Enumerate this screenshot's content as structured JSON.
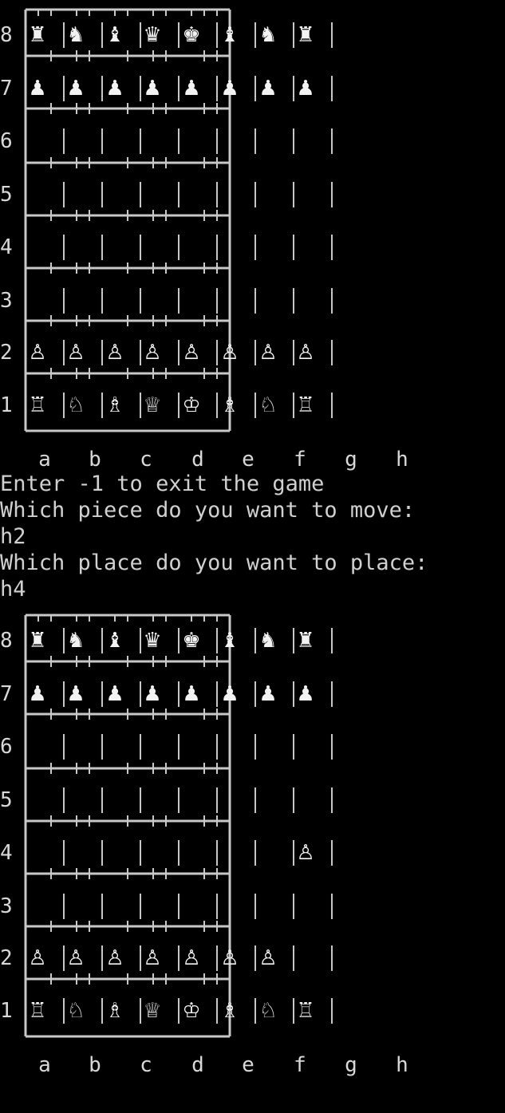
{
  "colors": {
    "background": "#000000",
    "text": "#d0d0d0",
    "lines": "#c8c8c8",
    "pieces": "#f2f2f2"
  },
  "rank_labels": [
    "8",
    "7",
    "6",
    "5",
    "4",
    "3",
    "2",
    "1"
  ],
  "file_labels": [
    "a",
    "b",
    "c",
    "d",
    "e",
    "f",
    "g",
    "h"
  ],
  "boards": [
    {
      "rows": [
        [
          "♜",
          "♞",
          "♝",
          "♛",
          "♚",
          "♝",
          "♞",
          "♜"
        ],
        [
          "♟",
          "♟",
          "♟",
          "♟",
          "♟",
          "♟",
          "♟",
          "♟"
        ],
        [
          "",
          "",
          "",
          "",
          "",
          "",
          "",
          ""
        ],
        [
          "",
          "",
          "",
          "",
          "",
          "",
          "",
          ""
        ],
        [
          "",
          "",
          "",
          "",
          "",
          "",
          "",
          ""
        ],
        [
          "",
          "",
          "",
          "",
          "",
          "",
          "",
          ""
        ],
        [
          "♙",
          "♙",
          "♙",
          "♙",
          "♙",
          "♙",
          "♙",
          "♙"
        ],
        [
          "♖",
          "♘",
          "♗",
          "♕",
          "♔",
          "♗",
          "♘",
          "♖"
        ]
      ]
    },
    {
      "rows": [
        [
          "♜",
          "♞",
          "♝",
          "♛",
          "♚",
          "♝",
          "♞",
          "♜"
        ],
        [
          "♟",
          "♟",
          "♟",
          "♟",
          "♟",
          "♟",
          "♟",
          "♟"
        ],
        [
          "",
          "",
          "",
          "",
          "",
          "",
          "",
          ""
        ],
        [
          "",
          "",
          "",
          "",
          "",
          "",
          "",
          ""
        ],
        [
          "",
          "",
          "",
          "",
          "",
          "",
          "",
          "♙"
        ],
        [
          "",
          "",
          "",
          "",
          "",
          "",
          "",
          ""
        ],
        [
          "♙",
          "♙",
          "♙",
          "♙",
          "♙",
          "♙",
          "♙",
          ""
        ],
        [
          "♖",
          "♘",
          "♗",
          "♕",
          "♔",
          "♗",
          "♘",
          "♖"
        ]
      ]
    }
  ],
  "console": {
    "exit_hint": "Enter -1 to exit the game",
    "move_prompt": "Which piece do you want to move:",
    "move_input": "h2",
    "place_prompt": "Which place do you want to place:",
    "place_input": "h4"
  }
}
